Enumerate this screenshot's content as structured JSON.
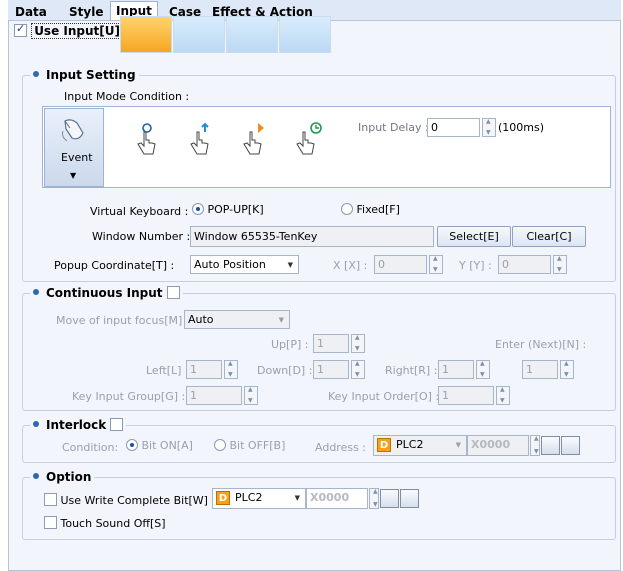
{
  "tabs": [
    "Data",
    "Style",
    "Input",
    "Case",
    "Effect & Action"
  ],
  "active_tab": "Input",
  "use_input": {
    "label": "Use Input[U]",
    "checked": true
  },
  "input_setting": {
    "title": "Input Setting",
    "mode_condition_label": "Input Mode Condition :",
    "event_label": "Event",
    "input_delay_label": "Input Delay :",
    "input_delay_value": "0",
    "input_delay_unit": "(100ms)",
    "virtual_keyboard_label": "Virtual Keyboard :",
    "popup_label": "POP-UP[K]",
    "fixed_label": "Fixed[F]",
    "window_number_label": "Window Number :",
    "window_number_value": "Window 65535-TenKey",
    "select_button": "Select[E]",
    "clear_button": "Clear[C]",
    "popup_coordinate_label": "Popup Coordinate[T] :",
    "popup_coordinate_value": "Auto Position",
    "x_label": "X [X] :",
    "x_value": "0",
    "y_label": "Y [Y] :",
    "y_value": "0"
  },
  "continuous_input": {
    "title": "Continuous Input",
    "move_focus_label": "Move of input focus[M] :",
    "move_focus_value": "Auto",
    "up_label": "Up[P] :",
    "up_value": "1",
    "enter_label": "Enter (Next)[N] :",
    "enter_value": "1",
    "left_label": "Left[L] :",
    "left_value": "1",
    "down_label": "Down[D] :",
    "down_value": "1",
    "right_label": "Right[R] :",
    "right_value": "1",
    "key_group_label": "Key Input Group[G] :",
    "key_group_value": "1",
    "key_order_label": "Key Input Order[O] :",
    "key_order_value": "1"
  },
  "interlock": {
    "title": "Interlock",
    "condition_label": "Condition:",
    "bit_on_label": "Bit ON[A]",
    "bit_off_label": "Bit OFF[B]",
    "address_label": "Address :",
    "device_value": "PLC2",
    "address_value": "X0000"
  },
  "option": {
    "title": "Option",
    "write_complete_label": "Use Write Complete Bit[W] :",
    "device_value": "PLC2",
    "address_value": "X0000",
    "touch_sound_label": "Touch Sound Off[S]"
  },
  "icons": {
    "device": "D",
    "accent": "#2f67b0",
    "selected_mode": "#f5a623"
  }
}
